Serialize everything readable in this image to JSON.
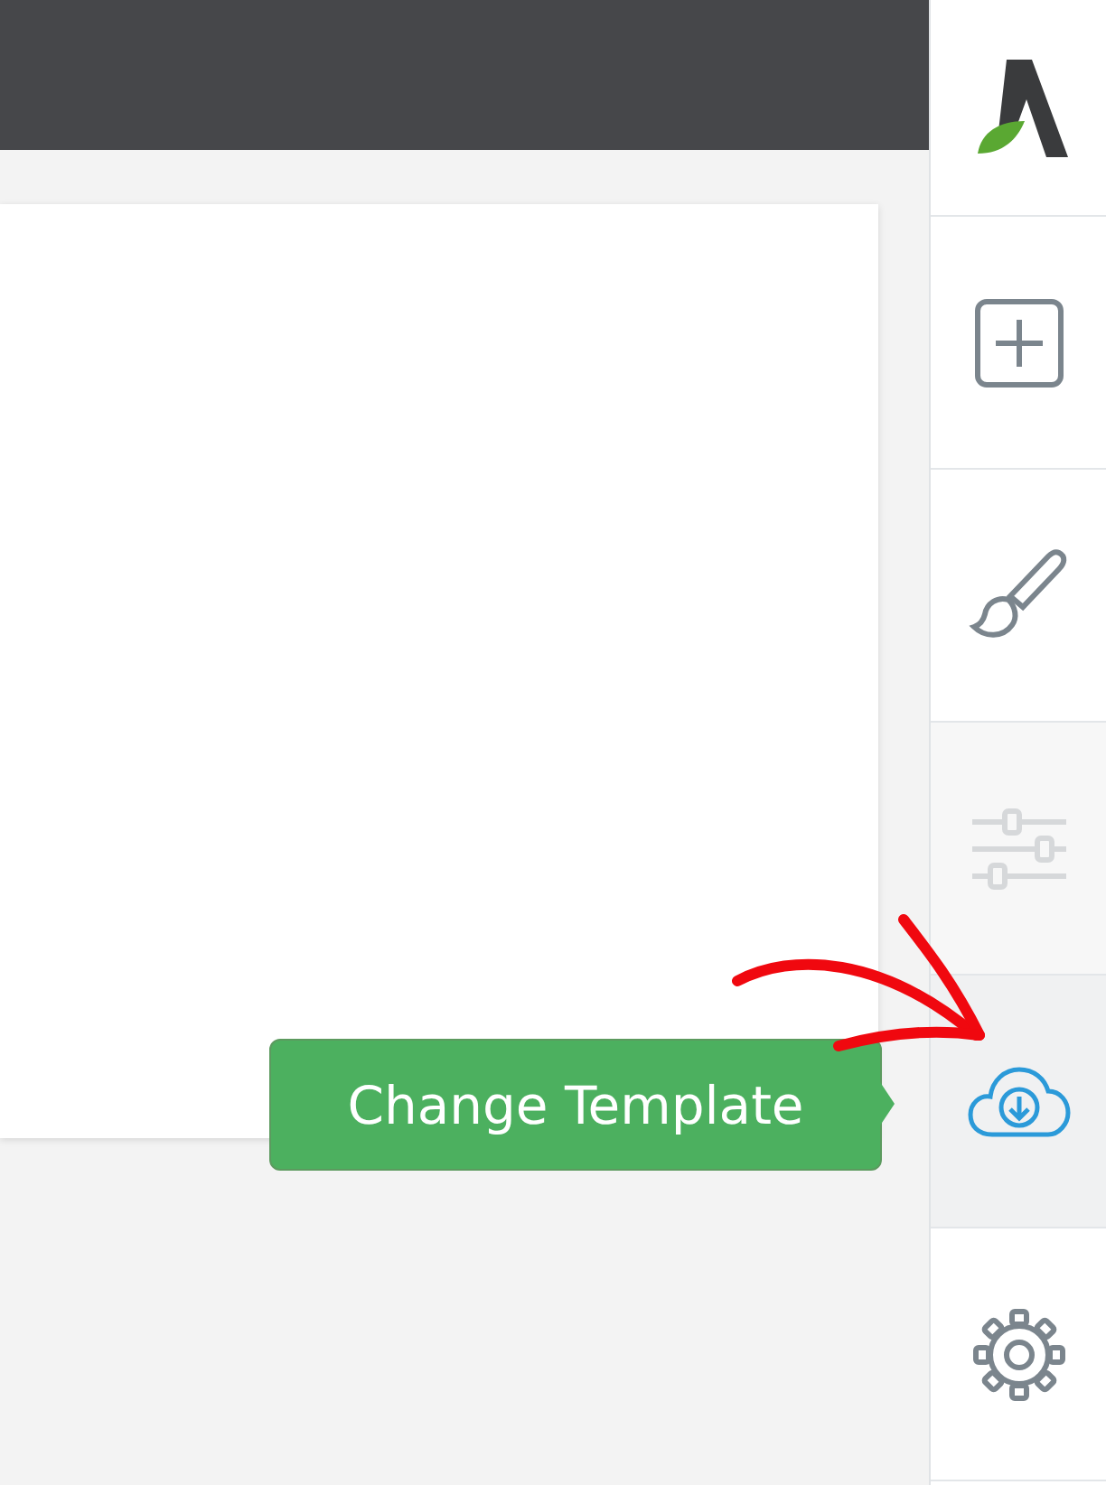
{
  "sidebar": {
    "items": [
      {
        "kind": "logo"
      },
      {
        "kind": "add",
        "selected": false,
        "disabled": false
      },
      {
        "kind": "brush",
        "selected": false,
        "disabled": false
      },
      {
        "kind": "sliders",
        "selected": false,
        "disabled": true
      },
      {
        "kind": "cloud",
        "selected": true,
        "disabled": false
      },
      {
        "kind": "settings",
        "selected": false,
        "disabled": false
      }
    ]
  },
  "tooltip": {
    "text": "Change Template"
  }
}
